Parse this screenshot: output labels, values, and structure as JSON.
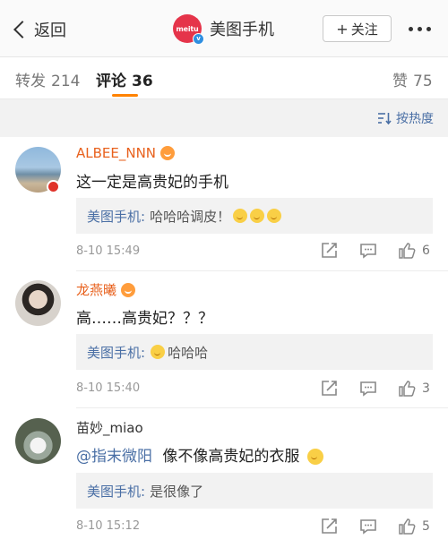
{
  "nav": {
    "back_label": "返回",
    "logo_text": "meitu",
    "account_name": "美图手机",
    "follow_label": "关注",
    "follow_plus": "+"
  },
  "tabs": {
    "repost_label": "转发",
    "repost_count": "214",
    "comment_label": "评论",
    "comment_count": "36",
    "like_label": "赞",
    "like_count": "75"
  },
  "sort": {
    "label": "按热度"
  },
  "colors": {
    "accent_orange": "#ff8200",
    "link_blue": "#4a6fa5",
    "brand_red": "#e5344a"
  },
  "comments": [
    {
      "username": "ALBEE_NNN",
      "username_color": "#e8611d",
      "text": "这一定是高贵妃的手机",
      "reply_name": "美图手机:",
      "reply_text": "哈哈哈调皮！",
      "time": "8-10 15:49",
      "likes": "6"
    },
    {
      "username": "龙燕曦",
      "username_color": "#e8611d",
      "text": "高……高贵妃？？？",
      "reply_name": "美图手机:",
      "reply_text": "哈哈哈",
      "time": "8-10 15:40",
      "likes": "3"
    },
    {
      "username": "苗妙_miao",
      "username_color": "#333333",
      "mention": "@指末微阳",
      "text": "像不像高贵妃的衣服",
      "reply_name": "美图手机:",
      "reply_text": "是很像了",
      "time": "8-10 15:12",
      "likes": "5"
    }
  ]
}
